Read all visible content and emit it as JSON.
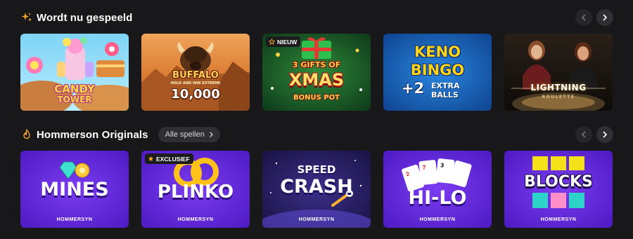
{
  "sections": [
    {
      "title": "Wordt nu gespeeld",
      "icon": "sparkles-icon",
      "games": [
        {
          "title": "Candy Tower",
          "line1": "CANDY",
          "line2": "TOWER"
        },
        {
          "title": "Buffalo Hold and Win Extreme 10,000",
          "line1": "BUFFALO",
          "line2": "HOLD AND WIN EXTREME",
          "line3": "10,000"
        },
        {
          "title": "3 Gifts of Xmas Bonus Pot",
          "badge": "NIEUW",
          "line1": "3 GIFTS OF",
          "line2": "XMAS",
          "line3": "BONUS POT"
        },
        {
          "title": "Keno Bingo +2 Extra Balls",
          "line1": "KENO",
          "line2": "BINGO",
          "line3": "+2",
          "line4": "EXTRA",
          "line5": "BALLS"
        },
        {
          "title": "Lightning Roulette",
          "line1": "LIGHTNING",
          "line2": "ROULETTE"
        }
      ]
    },
    {
      "title": "Hommerson Originals",
      "icon": "flame-icon",
      "all_label": "Alle spellen",
      "games": [
        {
          "title": "Mines",
          "line1": "MINES",
          "brand": "HOMMERSYN"
        },
        {
          "title": "Plinko",
          "badge": "EXCLUSIEF",
          "line1": "PLINKO",
          "brand": "HOMMERSYN"
        },
        {
          "title": "Speed Crash",
          "line1": "SPEED",
          "line2": "CRASH",
          "brand": "HOMMERSYN"
        },
        {
          "title": "Hi-Lo",
          "line1": "HI-LO",
          "brand": "HOMMERSYN"
        },
        {
          "title": "Blocks",
          "line1": "BLOCKS",
          "brand": "HOMMERSYN"
        }
      ]
    }
  ],
  "colors": {
    "background": "#18181b",
    "accent": "#f5a623",
    "originals_purple": "#5b22d6"
  }
}
